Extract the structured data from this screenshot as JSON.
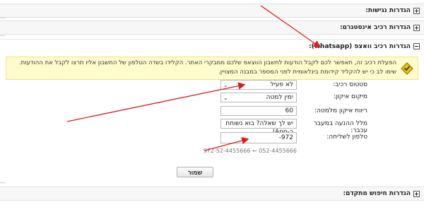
{
  "sections": {
    "accessibility": "הגדרות נגישות:",
    "instagram": "הגדרות רכיב אינסטגרם:",
    "whatsapp": "הגדרות רכיב וואצפ (whatsapp):",
    "advanced_search": "הגדרות חיפוש מתקדם:"
  },
  "notice": {
    "text": "הפעלת רכיב זה, תאפשר לכם לקבל הודעות לחשבון הווצאפ שלכם ממבקרי האתר. הקלידו בשדה הטלפון של החשבון אליו תרצו לקבל את ההודעות. שימו לב כי יש להקליד קידומת בינלאומית לפני המספר במבנה המצויין."
  },
  "form": {
    "status_label": "סטטוס רכיב:",
    "status_value": "לא פעיל",
    "position_label": "מיקום איקון:",
    "position_value": "ימין למטה",
    "margin_label": "ריווח איקון מלמטה:",
    "margin_value": "60",
    "message_label": "מלל ההנעה במעבר עכבר:",
    "message_value": "יש לך שאלה? בוא נשוחח ב-App!",
    "phone_label": "טלפון לשליחה:",
    "phone_value": "972-",
    "phone_hint": "972-52-4455666 ← 052-4455666"
  },
  "buttons": {
    "save": "שמור"
  },
  "icons": {
    "notice": "warning-icon"
  },
  "colors": {
    "notice_bg": "#fffbcc",
    "arrow": "#e01b1b"
  }
}
